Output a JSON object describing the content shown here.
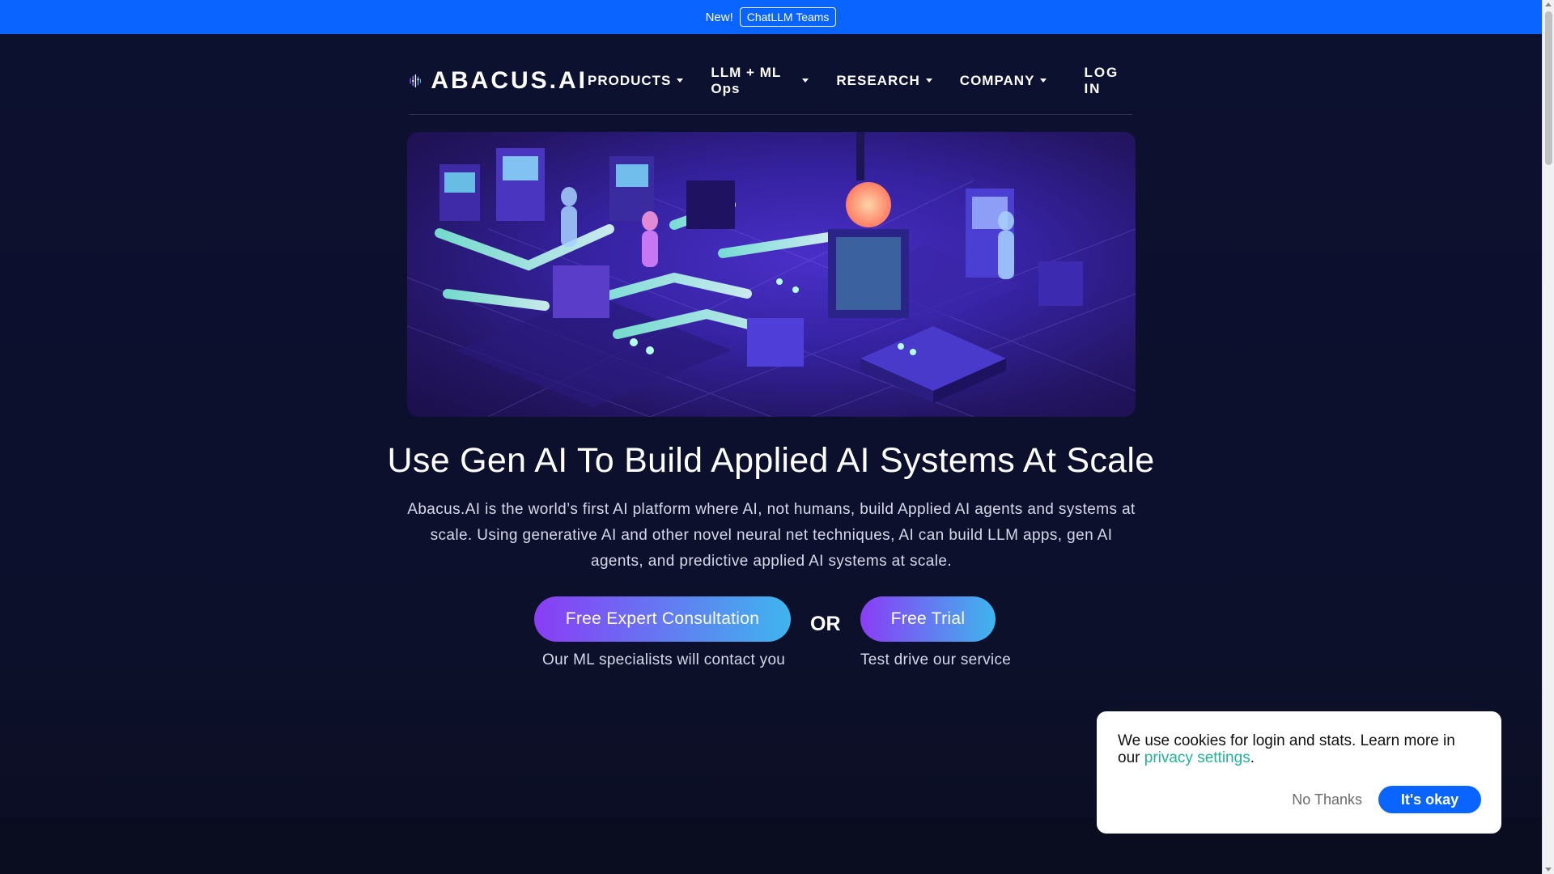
{
  "announcement": {
    "new_label": "New!",
    "chip_label": "ChatLLM Teams"
  },
  "nav": {
    "logo_text": "ABACUS.AI",
    "items": [
      {
        "label": "PRODUCTS"
      },
      {
        "label": "LLM + ML Ops"
      },
      {
        "label": "RESEARCH"
      },
      {
        "label": "COMPANY"
      }
    ],
    "login_label": "LOG IN"
  },
  "hero": {
    "headline": "Use Gen AI To Build Applied AI Systems At Scale",
    "subtext": "Abacus.AI is the world’s first AI platform where AI, not humans, build Applied AI agents and systems at scale. Using generative AI and other novel neural net techniques, AI can build LLM apps, gen AI agents, and predictive applied AI systems at scale."
  },
  "cta": {
    "consult_label": "Free Expert Consultation",
    "consult_caption": "Our ML specialists will contact you",
    "or_label": "OR",
    "trial_label": "Free Trial",
    "trial_caption": "Test drive our service"
  },
  "cookie": {
    "text_before": "We use cookies for login and stats. Learn more in our ",
    "link_label": "privacy settings",
    "text_after": ".",
    "decline_label": "No Thanks",
    "accept_label": "It's okay"
  },
  "colors": {
    "announcement_bg": "#0a64ff",
    "page_bg": "#0d1130",
    "cta_gradient_start": "#8a3df5",
    "cta_gradient_end": "#3fb5ee",
    "cookie_link": "#21b39a",
    "accept_button": "#0a64ff"
  },
  "icons": {
    "logo_mark": "abacus-bars-logo-icon",
    "dropdown": "caret-down-icon"
  }
}
